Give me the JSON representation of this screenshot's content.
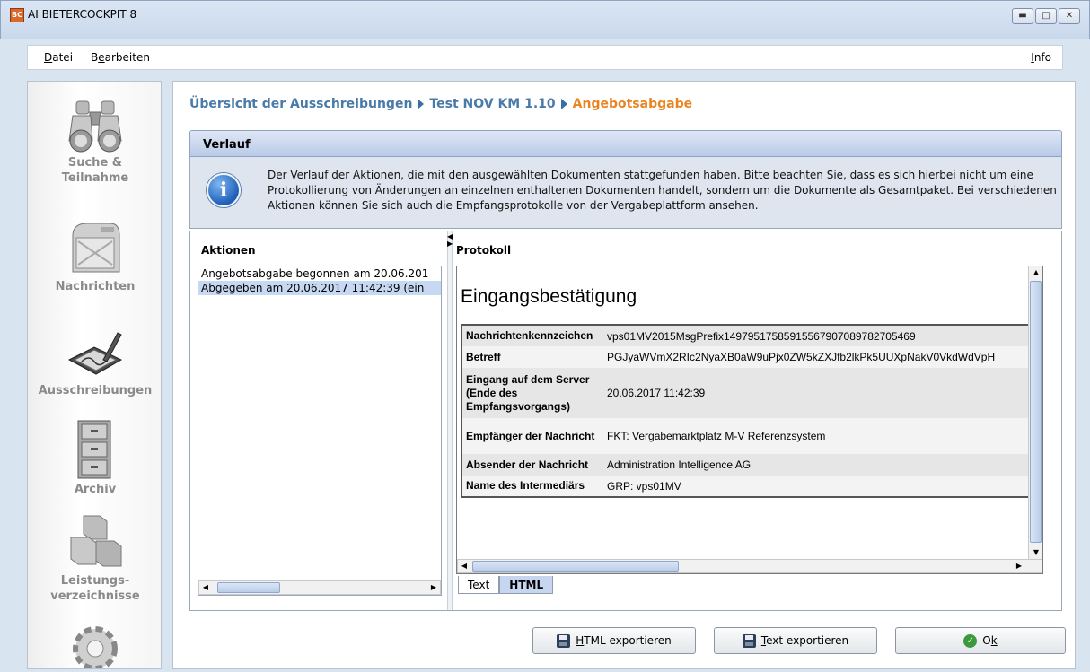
{
  "window": {
    "title": "AI BIETERCOCKPIT 8",
    "app_icon_text": "BC",
    "controls": [
      "minimize",
      "maximize",
      "close"
    ]
  },
  "menu": {
    "datei_first": "D",
    "datei_rest": "atei",
    "bearbeiten_first": "B",
    "bearbeiten_mnemonic": "e",
    "bearbeiten_rest": "arbeiten",
    "info_first": "I",
    "info_rest": "nfo"
  },
  "sidebar": {
    "items": [
      {
        "label_1": "Suche &",
        "label_2": "Teilnahme",
        "icon": "binoculars-icon",
        "active": false
      },
      {
        "label_1": "Nachrichten",
        "label_2": "",
        "icon": "mailbox-icon",
        "active": false
      },
      {
        "label_1": "Ausschreibungen",
        "label_2": "",
        "icon": "signature-tablet-icon",
        "active": true
      },
      {
        "label_1": "Archiv",
        "label_2": "",
        "icon": "filing-cabinet-icon",
        "active": false
      },
      {
        "label_1": "Leistungs-",
        "label_2": "verzeichnisse",
        "icon": "cubes-icon",
        "active": false
      },
      {
        "label_1": "",
        "label_2": "",
        "icon": "gear-icon",
        "active": false
      }
    ]
  },
  "breadcrumb": {
    "items": [
      "Übersicht der Ausschreibungen",
      "Test NOV KM 1.10"
    ],
    "current": "Angebotsabgabe"
  },
  "section": {
    "title": "Verlauf",
    "info_text": "Der Verlauf der Aktionen, die mit den ausgewählten Dokumenten stattgefunden haben. Bitte beachten Sie, dass es sich hierbei nicht um eine Protokollierung von Änderungen an einzelnen enthaltenen Dokumenten handelt, sondern um die Dokumente als Gesamtpaket. Bei verschiedenen Aktionen können Sie sich auch die Empfangsprotokolle von der Vergabeplattform ansehen."
  },
  "aktionen": {
    "title": "Aktionen",
    "items": [
      {
        "text": "Angebotsabgabe begonnen am 20.06.201",
        "selected": false
      },
      {
        "text": "Abgegeben am 20.06.2017 11:42:39 (ein",
        "selected": true
      }
    ]
  },
  "protokoll": {
    "title": "Protokoll",
    "heading": "Eingangsbestätigung",
    "rows": [
      {
        "label": "Nachrichtenkennzeichen",
        "value": "vps01MV2015MsgPrefix14979517585915567907089782705469"
      },
      {
        "label": "Betreff",
        "value": "PGJyaWVmX2RIc2NyaXB0aW9uPjx0ZW5kZXJfb2lkPk5UUXpNakV0VkdWdVpH"
      },
      {
        "label": "Eingang auf dem Server (Ende des Empfangsvorgangs)",
        "value": "20.06.2017 11:42:39"
      },
      {
        "label": "Empfänger der Nachricht",
        "value": "FKT: Vergabemarktplatz M-V Referenzsystem"
      },
      {
        "label": "Absender der Nachricht",
        "value": "Administration Intelligence AG"
      },
      {
        "label": "Name des Intermediärs",
        "value": "GRP: vps01MV"
      }
    ],
    "tabs": [
      {
        "label": "Text",
        "active": true
      },
      {
        "label": "HTML",
        "active": false
      }
    ]
  },
  "buttons": {
    "html_export": {
      "mnemonic": "H",
      "rest": "TML exportieren"
    },
    "text_export": {
      "mnemonic": "T",
      "rest": "ext exportieren"
    },
    "ok": {
      "first": "O",
      "mnemonic": "k"
    }
  }
}
